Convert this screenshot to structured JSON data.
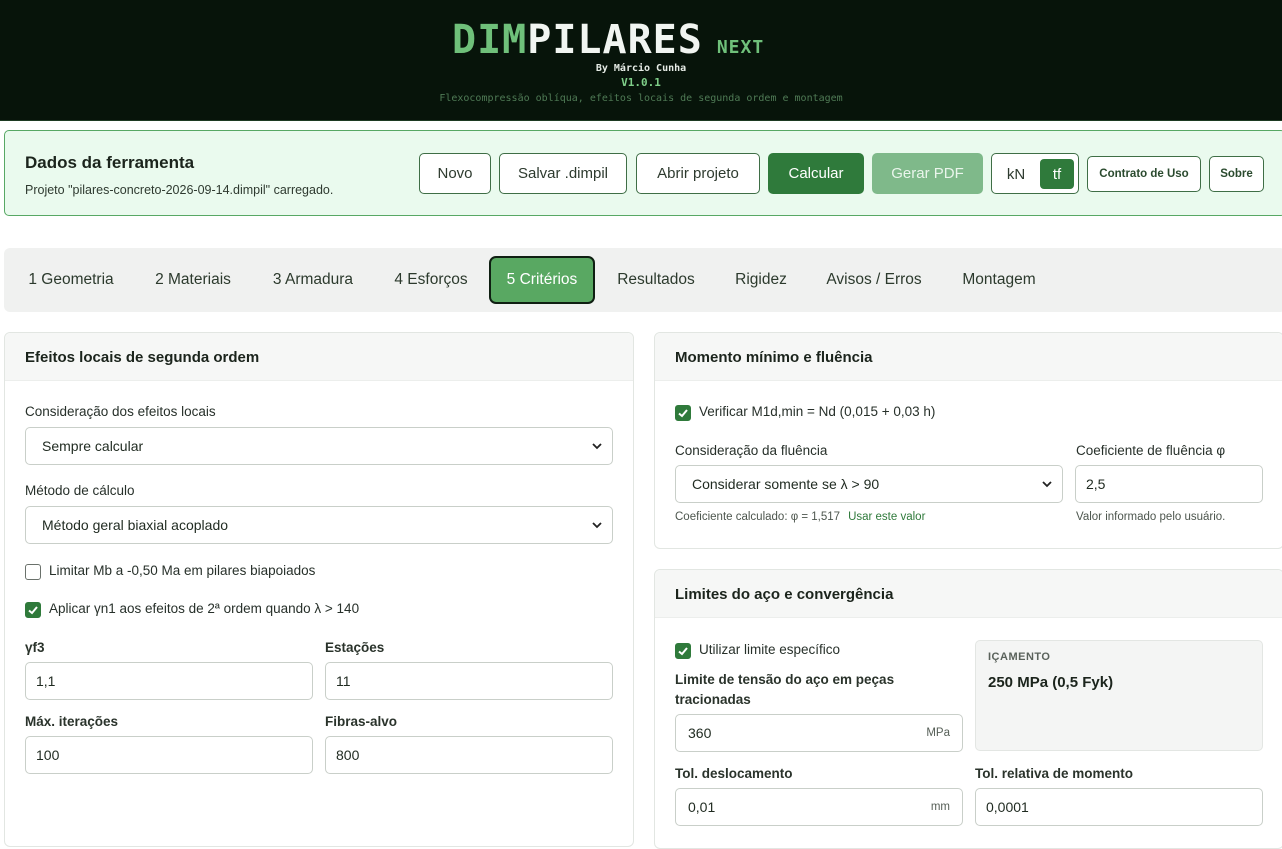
{
  "header": {
    "logo_dim": "DIM",
    "logo_pilares": "PILARES",
    "logo_next": "NEXT",
    "byline": "By Márcio Cunha",
    "version": "V1.0.1",
    "subtitle": "Flexocompressão oblíqua, efeitos locais de segunda ordem e montagem"
  },
  "toolbar": {
    "title": "Dados da ferramenta",
    "status": "Projeto \"pilares-concreto-2026-09-14.dimpil\" carregado.",
    "buttons": {
      "novo": "Novo",
      "salvar": "Salvar .dimpil",
      "abrir": "Abrir projeto",
      "calcular": "Calcular",
      "gerar_pdf": "Gerar PDF",
      "contrato": "Contrato de Uso",
      "sobre": "Sobre"
    },
    "units": {
      "kn": "kN",
      "tf": "tf",
      "selected": "tf"
    }
  },
  "tabs": [
    {
      "label": "1 Geometria"
    },
    {
      "label": "2 Materiais"
    },
    {
      "label": "3 Armadura"
    },
    {
      "label": "4 Esforços"
    },
    {
      "label": "5 Critérios",
      "active": true
    },
    {
      "label": "Resultados"
    },
    {
      "label": "Rigidez"
    },
    {
      "label": "Avisos / Erros"
    },
    {
      "label": "Montagem"
    }
  ],
  "left_panel": {
    "title": "Efeitos locais de segunda ordem",
    "consideracao_label": "Consideração dos efeitos locais",
    "consideracao_value": "Sempre calcular",
    "metodo_label": "Método de cálculo",
    "metodo_value": "Método geral biaxial acoplado",
    "limitar_mb_label": "Limitar Mb a -0,50 Ma em pilares biapoiados",
    "limitar_mb_checked": false,
    "aplicar_gn1_label": "Aplicar γn1 aos efeitos de 2ª ordem quando λ > 140",
    "aplicar_gn1_checked": true,
    "gf3_label": "γf3",
    "gf3_value": "1,1",
    "estacoes_label": "Estações",
    "estacoes_value": "11",
    "max_iter_label": "Máx. iterações",
    "max_iter_value": "100",
    "fibras_label": "Fibras-alvo",
    "fibras_value": "800"
  },
  "momento_panel": {
    "title": "Momento mínimo e fluência",
    "verificar_label": "Verificar M1d,min = Nd (0,015 + 0,03 h)",
    "verificar_checked": true,
    "fluencia_label": "Consideração da fluência",
    "fluencia_value": "Considerar somente se λ > 90",
    "coef_label": "Coeficiente de fluência φ",
    "coef_value": "2,5",
    "coef_calc_hint": "Coeficiente calculado: φ = 1,517",
    "usar_link": "Usar este valor",
    "coef_user_hint": "Valor informado pelo usuário."
  },
  "limites_panel": {
    "title": "Limites do aço e convergência",
    "utilizar_label": "Utilizar limite específico",
    "utilizar_checked": true,
    "limite_label_1": "Limite de tensão do aço em peças",
    "limite_label_2": "tracionadas",
    "limite_value": "360",
    "limite_unit": "MPa",
    "icamento_label": "IÇAMENTO",
    "icamento_value": "250 MPa (0,5 Fyk)",
    "tol_desl_label": "Tol. deslocamento",
    "tol_desl_value": "0,01",
    "tol_desl_unit": "mm",
    "tol_mom_label": "Tol. relativa de momento",
    "tol_mom_value": "0,0001"
  },
  "colors": {
    "header_bg": "#07140a",
    "accent": "#2f7a3b",
    "accent_light": "#59a862",
    "toolbar_bg": "#eafaee"
  }
}
